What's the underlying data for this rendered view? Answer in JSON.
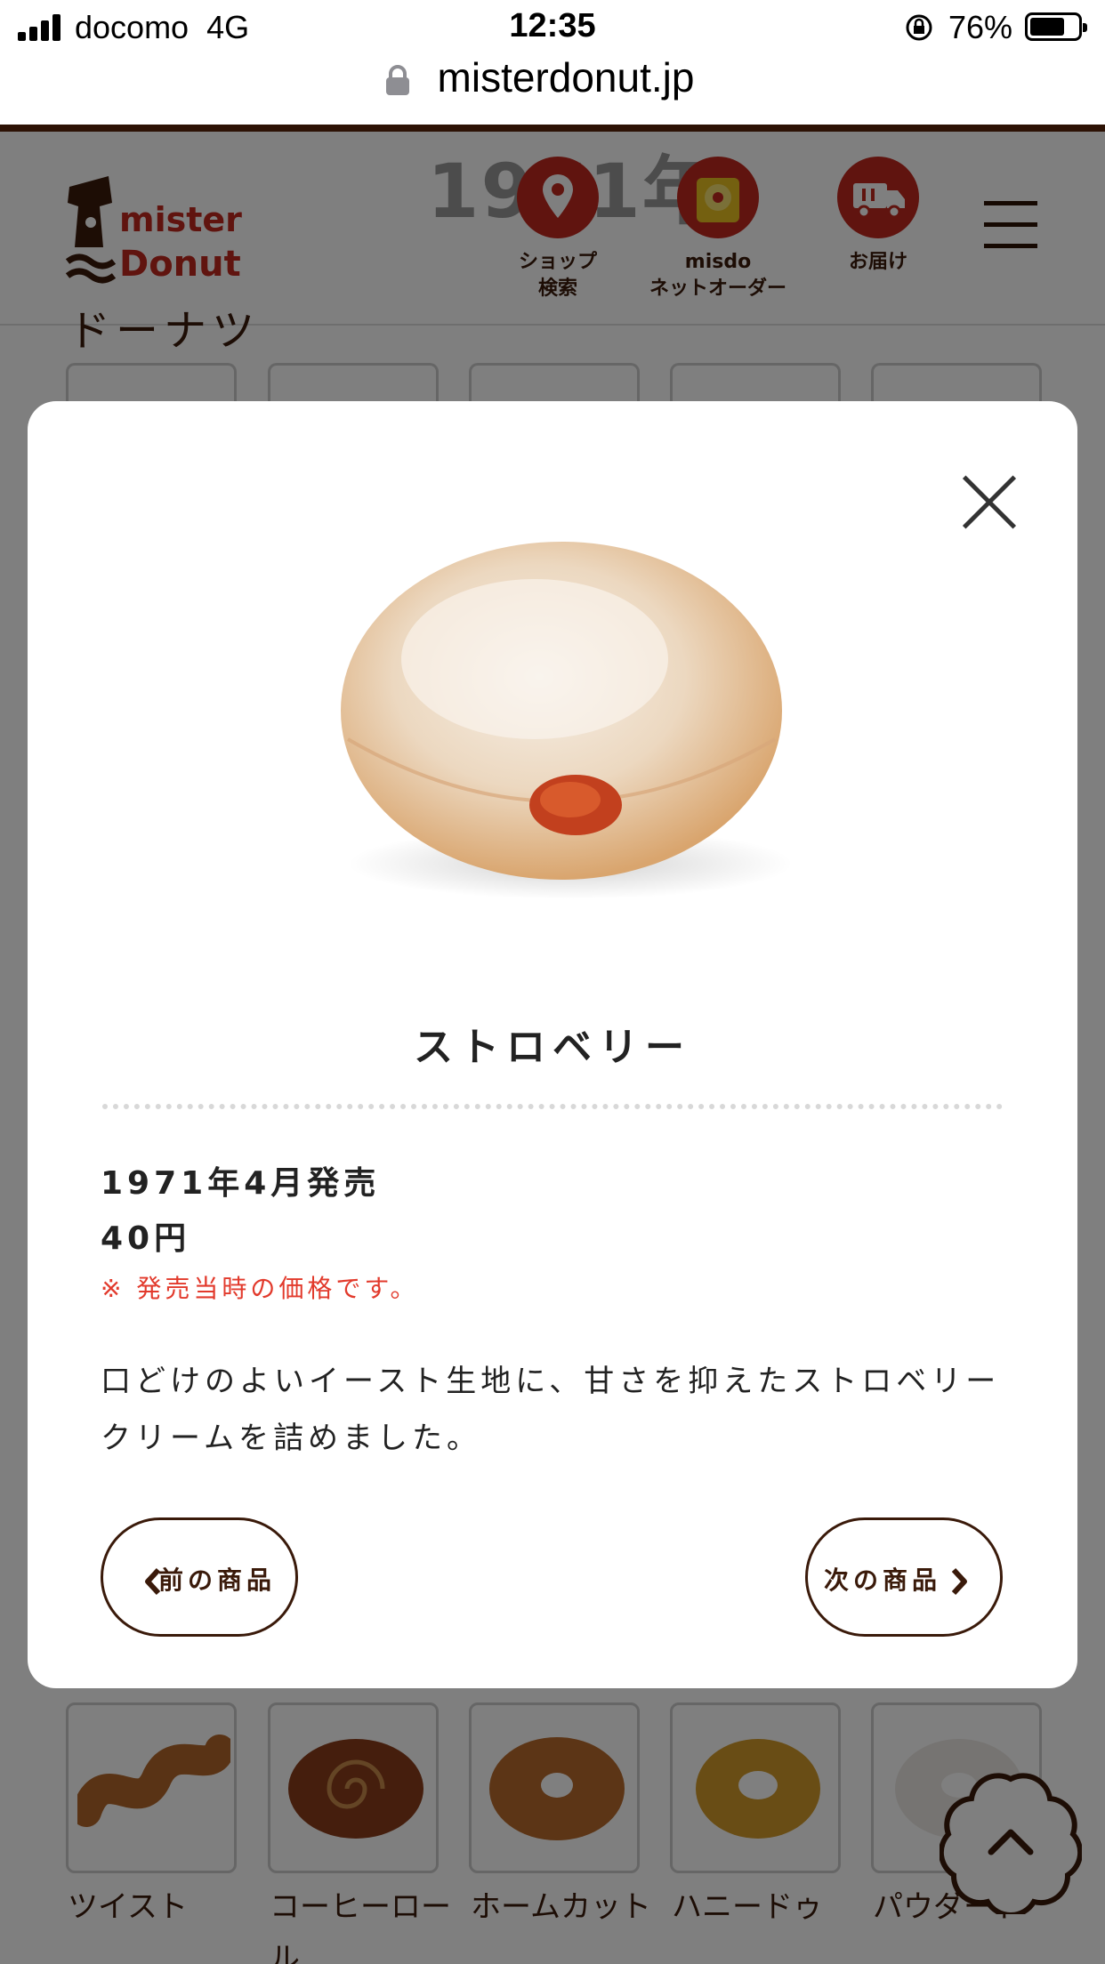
{
  "status_bar": {
    "carrier": "docomo",
    "network": "4G",
    "time": "12:35",
    "battery_percent": "76%",
    "battery_level": 0.76
  },
  "browser": {
    "url": "misterdonut.jp"
  },
  "site": {
    "logo_line1": "mister",
    "logo_line2": "Donut",
    "year_heading": "1971年",
    "nav": [
      {
        "label": "ショップ\n検索",
        "icon": "map-pin-icon"
      },
      {
        "label": "misdo\nネットオーダー",
        "icon": "donut-bag-icon"
      },
      {
        "label": "お届け",
        "icon": "delivery-truck-icon"
      }
    ],
    "section_title": "ドーナツ"
  },
  "bottom_products": [
    {
      "label": "ツイスト",
      "label_wrap": ""
    },
    {
      "label": "コーヒーロー",
      "label_wrap": "ル"
    },
    {
      "label": "ホームカット",
      "label_wrap": ""
    },
    {
      "label": "ハニードゥ",
      "label_wrap": ""
    },
    {
      "label": "パウダード",
      "label_wrap": ""
    }
  ],
  "modal": {
    "product_name": "ストロベリー",
    "release": "1971年4月発売",
    "price": "40円",
    "note": "※ 発売当時の価格です。",
    "description": "口どけのよいイースト生地に、甘さを抑えたストロベリークリームを詰めました。",
    "prev_label": "前の商品",
    "next_label": "次の商品"
  },
  "colors": {
    "brand_brown": "#3a1a0a",
    "accent_red": "#c0281e",
    "note_red": "#e23a2c"
  }
}
